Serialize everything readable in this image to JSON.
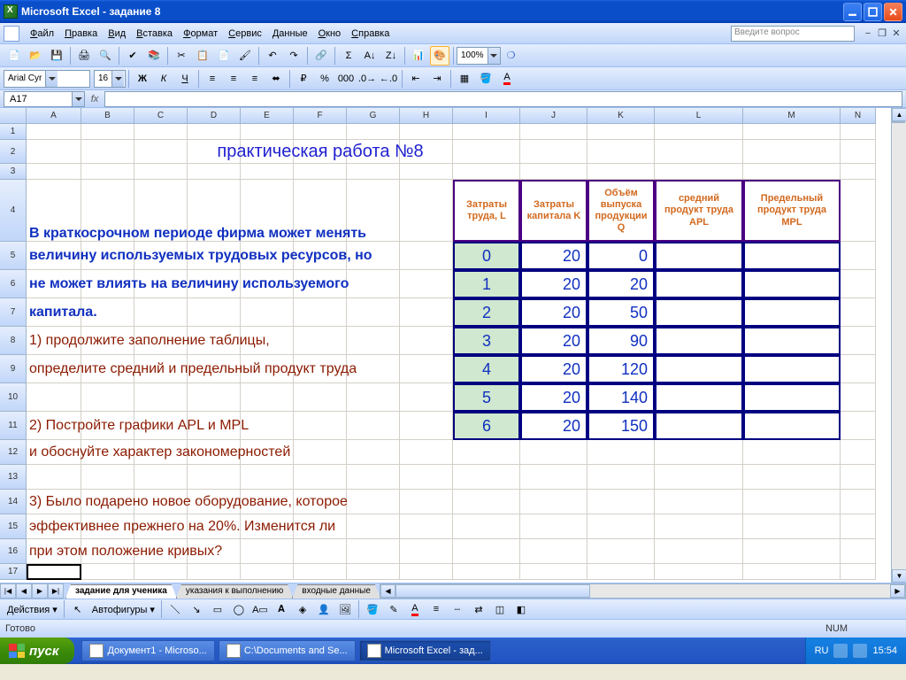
{
  "title": "Microsoft Excel - задание 8",
  "menus": [
    "Файл",
    "Правка",
    "Вид",
    "Вставка",
    "Формат",
    "Сервис",
    "Данные",
    "Окно",
    "Справка"
  ],
  "question_placeholder": "Введите вопрос",
  "zoom": "100%",
  "font": "Arial Cyr",
  "font_size": "16",
  "name_box": "A17",
  "columns": [
    {
      "l": "A",
      "w": 62
    },
    {
      "l": "B",
      "w": 60
    },
    {
      "l": "C",
      "w": 60
    },
    {
      "l": "D",
      "w": 60
    },
    {
      "l": "E",
      "w": 60
    },
    {
      "l": "F",
      "w": 60
    },
    {
      "l": "G",
      "w": 60
    },
    {
      "l": "H",
      "w": 60
    },
    {
      "l": "I",
      "w": 76
    },
    {
      "l": "J",
      "w": 76
    },
    {
      "l": "K",
      "w": 76
    },
    {
      "l": "L",
      "w": 100
    },
    {
      "l": "M",
      "w": 110
    },
    {
      "l": "N",
      "w": 40
    }
  ],
  "rows": [
    {
      "n": 1,
      "h": 18
    },
    {
      "n": 2,
      "h": 27
    },
    {
      "n": 3,
      "h": 18
    },
    {
      "n": 4,
      "h": 70
    },
    {
      "n": 5,
      "h": 32
    },
    {
      "n": 6,
      "h": 32
    },
    {
      "n": 7,
      "h": 32
    },
    {
      "n": 8,
      "h": 32
    },
    {
      "n": 9,
      "h": 32
    },
    {
      "n": 10,
      "h": 32
    },
    {
      "n": 11,
      "h": 32
    },
    {
      "n": 12,
      "h": 28
    },
    {
      "n": 13,
      "h": 28
    },
    {
      "n": 14,
      "h": 28
    },
    {
      "n": 15,
      "h": 28
    },
    {
      "n": 16,
      "h": 28
    },
    {
      "n": 17,
      "h": 18
    }
  ],
  "worksheet_title": "практическая работа №8",
  "text_lines": {
    "r4": "В краткосрочном периоде фирма может менять",
    "r5": "величину используемых трудовых ресурсов, но",
    "r6": "не может влиять на величину используемого",
    "r7": "капитала.",
    "r8": "1) продолжите заполнение таблицы,",
    "r9": "    определите средний и предельный продукт труда",
    "r11": "2) Постройте графики APL и MPL",
    "r12": "    и обоснуйте характер закономерностей",
    "r14": "3) Было подарено новое оборудование, которое",
    "r15": "    эффективнее прежнего на 20%. Изменится ли",
    "r16": "    при этом положение кривых?"
  },
  "table_headers": [
    "Затраты труда, L",
    "Затраты капитала K",
    "Объём выпуска продукции Q",
    "средний продукт труда APL",
    "Предельный продукт труда MPL"
  ],
  "table_rows": [
    {
      "L": "0",
      "K": "20",
      "Q": "0"
    },
    {
      "L": "1",
      "K": "20",
      "Q": "20"
    },
    {
      "L": "2",
      "K": "20",
      "Q": "50"
    },
    {
      "L": "3",
      "K": "20",
      "Q": "90"
    },
    {
      "L": "4",
      "K": "20",
      "Q": "120"
    },
    {
      "L": "5",
      "K": "20",
      "Q": "140"
    },
    {
      "L": "6",
      "K": "20",
      "Q": "150"
    }
  ],
  "sheet_tabs": [
    "задание для ученика",
    "указания к выполнению",
    "входные данные"
  ],
  "active_tab": 0,
  "draw_labels": {
    "actions": "Действия",
    "autoshapes": "Автофигуры"
  },
  "status": "Готово",
  "status_right": "NUM",
  "taskbar": {
    "start": "пуск",
    "items": [
      "Документ1 - Microso...",
      "C:\\Documents and Se...",
      "Microsoft Excel - зад..."
    ],
    "active": 2,
    "lang": "RU",
    "time": "15:54"
  }
}
